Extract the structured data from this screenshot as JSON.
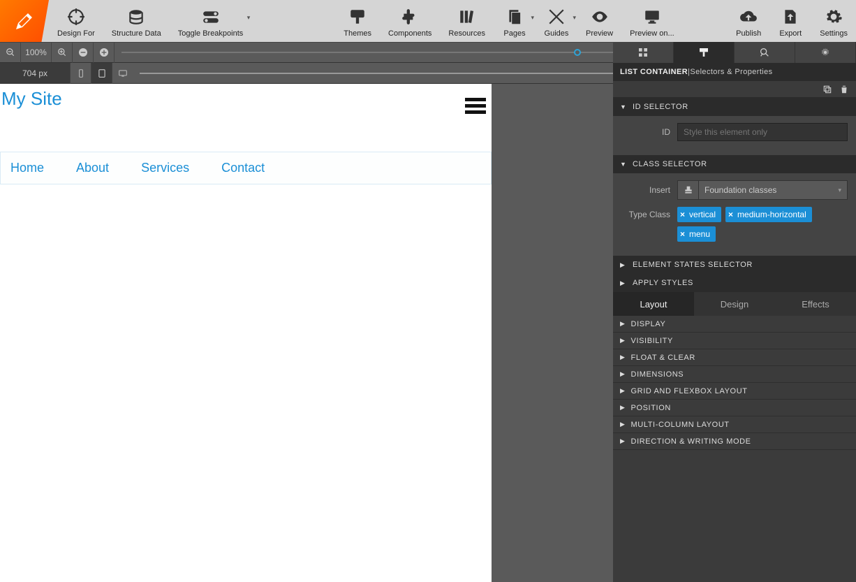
{
  "toolbar": {
    "design_for": "Design For",
    "structure_data": "Structure Data",
    "toggle_breakpoints": "Toggle Breakpoints",
    "themes": "Themes",
    "components": "Components",
    "resources": "Resources",
    "pages": "Pages",
    "guides": "Guides",
    "preview": "Preview",
    "preview_on": "Preview on...",
    "publish": "Publish",
    "export": "Export",
    "settings": "Settings"
  },
  "zoom": {
    "value": "100%"
  },
  "breakpoint": {
    "width_label": "704 px"
  },
  "canvas": {
    "site_title": "My Site",
    "nav": {
      "home": "Home",
      "about": "About",
      "services": "Services",
      "contact": "Contact"
    }
  },
  "panel": {
    "context_label": "LIST CONTAINER",
    "context_sep": " | ",
    "context_sub": "Selectors & Properties",
    "id_selector_title": "ID SELECTOR",
    "id_label": "ID",
    "id_placeholder": "Style this element only",
    "class_selector_title": "CLASS SELECTOR",
    "insert_label": "Insert",
    "insert_select": "Foundation classes",
    "type_class_label": "Type Class",
    "tags": {
      "t0": "vertical",
      "t1": "medium-horizontal",
      "t2": "menu"
    },
    "element_states": "ELEMENT STATES SELECTOR",
    "apply_styles": "APPLY STYLES",
    "subtabs": {
      "layout": "Layout",
      "design": "Design",
      "effects": "Effects"
    },
    "props": {
      "p0": "DISPLAY",
      "p1": "VISIBILITY",
      "p2": "FLOAT & CLEAR",
      "p3": "DIMENSIONS",
      "p4": "GRID AND FLEXBOX LAYOUT",
      "p5": "POSITION",
      "p6": "MULTI-COLUMN LAYOUT",
      "p7": "DIRECTION & WRITING MODE"
    }
  }
}
